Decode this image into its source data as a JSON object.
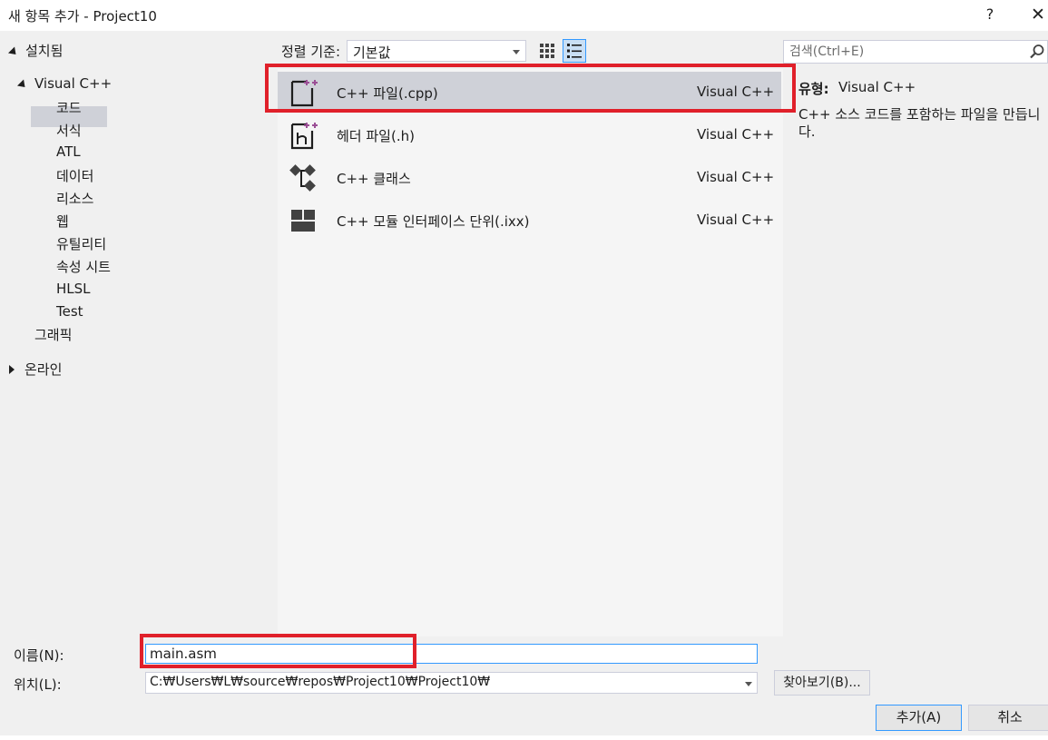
{
  "window": {
    "title": "새 항목 추가 - Project10",
    "help_label": "?",
    "close_label": "✕"
  },
  "tree": {
    "installed_label": "설치됨",
    "visual_cpp_label": "Visual C++",
    "children": [
      "코드",
      "서식",
      "ATL",
      "데이터",
      "리소스",
      "웹",
      "유틸리티",
      "속성 시트",
      "HLSL",
      "Test"
    ],
    "graphics_label": "그래픽",
    "online_label": "온라인"
  },
  "toolbar": {
    "sort_label": "정렬 기준:",
    "sort_value": "기본값"
  },
  "search": {
    "placeholder": "검색(Ctrl+E)"
  },
  "templates": [
    {
      "name": "C++ 파일(.cpp)",
      "lang": "Visual C++",
      "icon": "cpp-file-icon"
    },
    {
      "name": "헤더 파일(.h)",
      "lang": "Visual C++",
      "icon": "header-file-icon"
    },
    {
      "name": "C++ 클래스",
      "lang": "Visual C++",
      "icon": "class-icon"
    },
    {
      "name": "C++ 모듈 인터페이스 단위(.ixx)",
      "lang": "Visual C++",
      "icon": "module-interface-icon"
    }
  ],
  "description": {
    "type_label": "유형:",
    "type_value": "Visual C++",
    "text_line1": "C++ 소스 코드를 포함하는 파일을 만듭니",
    "text_line2": "다."
  },
  "form": {
    "name_label": "이름(N):",
    "name_value": "main.asm",
    "location_label": "위치(L):",
    "location_value": "C:₩Users₩L₩source₩repos₩Project10₩Project10₩",
    "browse_label": "찾아보기(B)...",
    "add_label": "추가(A)",
    "cancel_label": "취소"
  },
  "colors": {
    "accent": "#3399ff",
    "selection": "#cfd1d8",
    "highlight_red": "#e0202a",
    "icon_purple": "#9b4f96"
  }
}
